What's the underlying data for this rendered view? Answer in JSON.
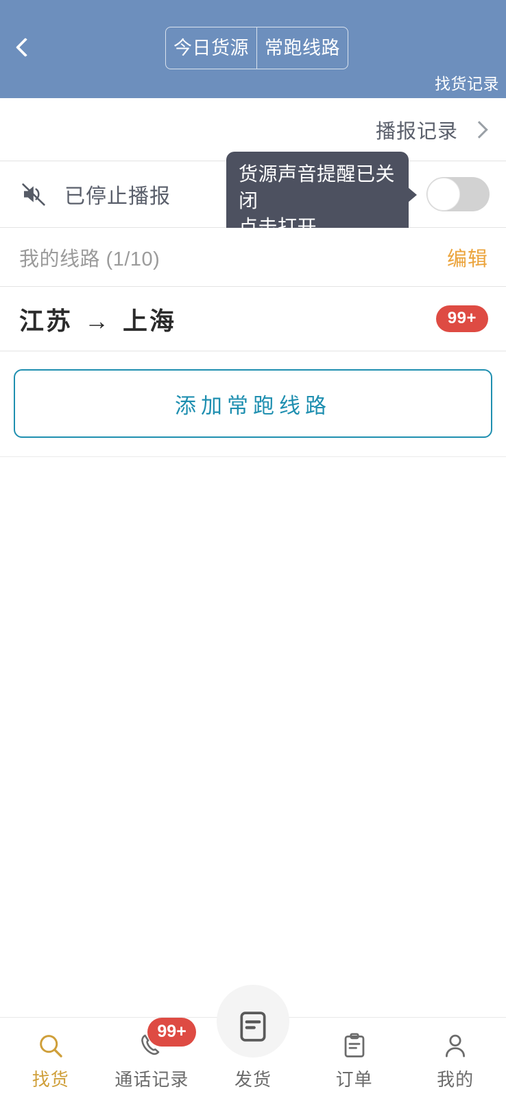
{
  "header": {
    "back_icon": "chevron-left-icon",
    "segments": [
      {
        "label": "今日货源",
        "selected": false
      },
      {
        "label": "常跑线路",
        "selected": true
      }
    ],
    "right_link": "找货记录",
    "bg_color": "#6d8fbd"
  },
  "broadcast": {
    "label": "播报记录",
    "chevron_icon": "chevron-right-icon"
  },
  "mute": {
    "icon": "speaker-mute-icon",
    "label": "已停止播报",
    "toggle_state": "off",
    "tooltip_line1": "货源声音提醒已关闭",
    "tooltip_line2": "点击打开",
    "tooltip_bg": "#4d5160"
  },
  "my_routes": {
    "title": "我的线路 (1/10)",
    "count_current": 1,
    "count_max": 10,
    "edit_label": "编辑",
    "edit_color": "#eba43d"
  },
  "routes": [
    {
      "origin": "江苏",
      "arrow": "→",
      "destination": "上海",
      "badge": "99+",
      "badge_color": "#de4b43"
    }
  ],
  "add_button": {
    "label": "添加常跑线路",
    "color": "#1f8fb0"
  },
  "tabbar": {
    "active_color": "#cf9f3a",
    "inactive_color": "#6b6b6b",
    "items": [
      {
        "label": "找货",
        "icon": "search-icon",
        "active": true,
        "badge": ""
      },
      {
        "label": "通话记录",
        "icon": "phone-icon",
        "active": false,
        "badge": "99+"
      },
      {
        "label": "发货",
        "icon": "document-icon",
        "active": false,
        "badge": ""
      },
      {
        "label": "订单",
        "icon": "clipboard-icon",
        "active": false,
        "badge": ""
      },
      {
        "label": "我的",
        "icon": "person-icon",
        "active": false,
        "badge": ""
      }
    ]
  }
}
